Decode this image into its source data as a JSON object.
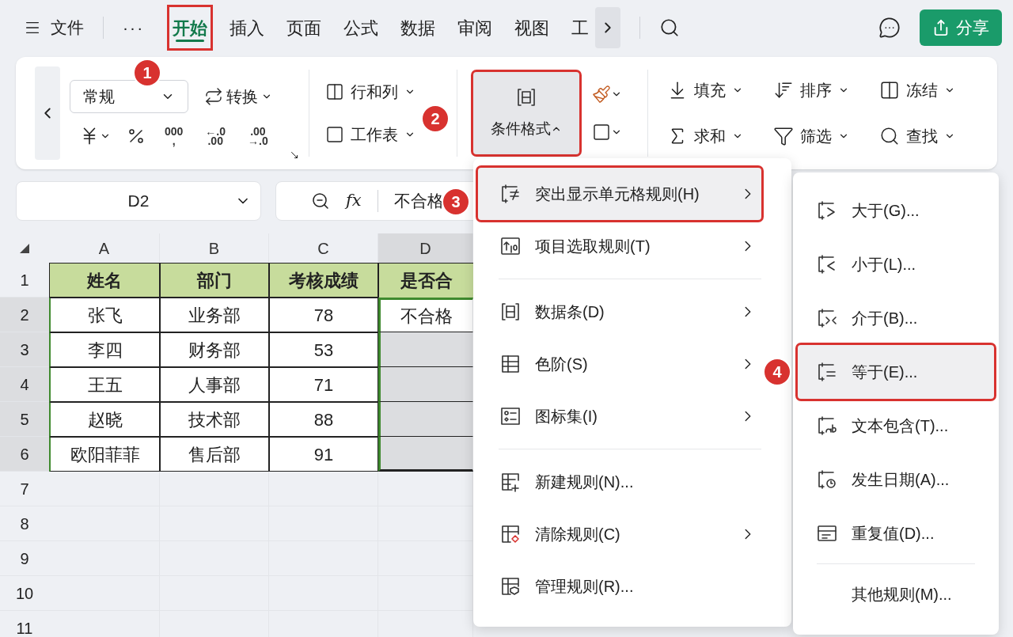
{
  "top_bar": {
    "menu_label": "文件",
    "more": "···",
    "tabs": [
      {
        "label": "开始",
        "selected": true,
        "annotated": true
      },
      {
        "label": "插入",
        "selected": false,
        "annotated": false
      },
      {
        "label": "页面",
        "selected": false,
        "annotated": false
      },
      {
        "label": "公式",
        "selected": false,
        "annotated": false
      },
      {
        "label": "数据",
        "selected": false,
        "annotated": false
      },
      {
        "label": "审阅",
        "selected": false,
        "annotated": false
      },
      {
        "label": "视图",
        "selected": false,
        "annotated": false
      },
      {
        "label": "工",
        "selected": false,
        "annotated": false
      }
    ],
    "share": "分享"
  },
  "ribbon": {
    "number_format": "常规",
    "convert": "转换",
    "thousands": [
      "000",
      ","
    ],
    "decimal_increase": [
      "←.0",
      ".00"
    ],
    "decimal_decrease": [
      ".00",
      "→.0"
    ],
    "row_col": "行和列",
    "worksheet": "工作表",
    "conditional_format": {
      "label": "条件格式",
      "annotated": true
    },
    "tools": [
      {
        "label": "填充",
        "kind": "fill"
      },
      {
        "label": "排序",
        "kind": "sort"
      },
      {
        "label": "冻结",
        "kind": "freeze"
      },
      {
        "label": "求和",
        "kind": "sum"
      },
      {
        "label": "筛选",
        "kind": "filter"
      },
      {
        "label": "查找",
        "kind": "find"
      }
    ]
  },
  "formula_bar": {
    "name_box": "D2",
    "fx": "fx",
    "value": "不合格"
  },
  "sheet": {
    "columns": [
      {
        "label": "A",
        "selected": false
      },
      {
        "label": "B",
        "selected": false
      },
      {
        "label": "C",
        "selected": false
      },
      {
        "label": "D",
        "selected": true
      }
    ],
    "rows": [
      {
        "number": "1",
        "selected": false,
        "active": false,
        "kind": "header",
        "cells": [
          "姓名",
          "部门",
          "考核成绩",
          "是否合"
        ]
      },
      {
        "number": "2",
        "selected": true,
        "active": true,
        "kind": "data",
        "cells": [
          "张飞",
          "业务部",
          "78",
          "不合格"
        ]
      },
      {
        "number": "3",
        "selected": true,
        "active": false,
        "kind": "data",
        "cells": [
          "李四",
          "财务部",
          "53"
        ]
      },
      {
        "number": "4",
        "selected": true,
        "active": false,
        "kind": "data",
        "cells": [
          "王五",
          "人事部",
          "71"
        ]
      },
      {
        "number": "5",
        "selected": true,
        "active": false,
        "kind": "data",
        "cells": [
          "赵晓",
          "技术部",
          "88"
        ]
      },
      {
        "number": "6",
        "selected": true,
        "active": false,
        "kind": "data",
        "cells": [
          "欧阳菲菲",
          "售后部",
          "91"
        ]
      },
      {
        "number": "7",
        "selected": false,
        "active": false,
        "kind": "empty"
      },
      {
        "number": "8",
        "selected": false,
        "active": false,
        "kind": "empty"
      },
      {
        "number": "9",
        "selected": false,
        "active": false,
        "kind": "empty"
      },
      {
        "number": "10",
        "selected": false,
        "active": false,
        "kind": "empty"
      },
      {
        "number": "11",
        "selected": false,
        "active": false,
        "kind": "empty"
      }
    ]
  },
  "menu": {
    "items": [
      {
        "label": "突出显示单元格规则(H)",
        "kind": "highlight",
        "submenu": true,
        "selected": true,
        "annotated": true
      },
      {
        "label": "项目选取规则(T)",
        "kind": "top10",
        "submenu": true,
        "selected": false,
        "annotated": false
      },
      {
        "kind": "divider"
      },
      {
        "label": "数据条(D)",
        "kind": "databar",
        "submenu": true,
        "selected": false,
        "annotated": false
      },
      {
        "label": "色阶(S)",
        "kind": "scale",
        "submenu": true,
        "selected": false,
        "annotated": false
      },
      {
        "label": "图标集(I)",
        "kind": "iconset",
        "submenu": true,
        "selected": false,
        "annotated": false
      },
      {
        "kind": "divider"
      },
      {
        "label": "新建规则(N)...",
        "kind": "new",
        "submenu": false,
        "selected": false,
        "annotated": false
      },
      {
        "label": "清除规则(C)",
        "kind": "clear",
        "submenu": true,
        "selected": false,
        "annotated": false
      },
      {
        "label": "管理规则(R)...",
        "kind": "manage",
        "submenu": false,
        "selected": false,
        "annotated": false
      }
    ]
  },
  "submenu": {
    "items": [
      {
        "label": "大于(G)...",
        "kind": "greater",
        "selected": false,
        "annotated": false
      },
      {
        "label": "小于(L)...",
        "kind": "less",
        "selected": false,
        "annotated": false
      },
      {
        "label": "介于(B)...",
        "kind": "between",
        "selected": false,
        "annotated": false
      },
      {
        "label": "等于(E)...",
        "kind": "equal",
        "selected": true,
        "annotated": true
      },
      {
        "label": "文本包含(T)...",
        "kind": "text",
        "selected": false,
        "annotated": false
      },
      {
        "label": "发生日期(A)...",
        "kind": "date",
        "selected": false,
        "annotated": false
      },
      {
        "label": "重复值(D)...",
        "kind": "duplicate",
        "selected": false,
        "annotated": false
      },
      {
        "kind": "divider"
      },
      {
        "label": "其他规则(M)...",
        "kind": "other",
        "selected": false,
        "annotated": false
      }
    ]
  },
  "callouts": [
    "1",
    "2",
    "3",
    "4"
  ]
}
